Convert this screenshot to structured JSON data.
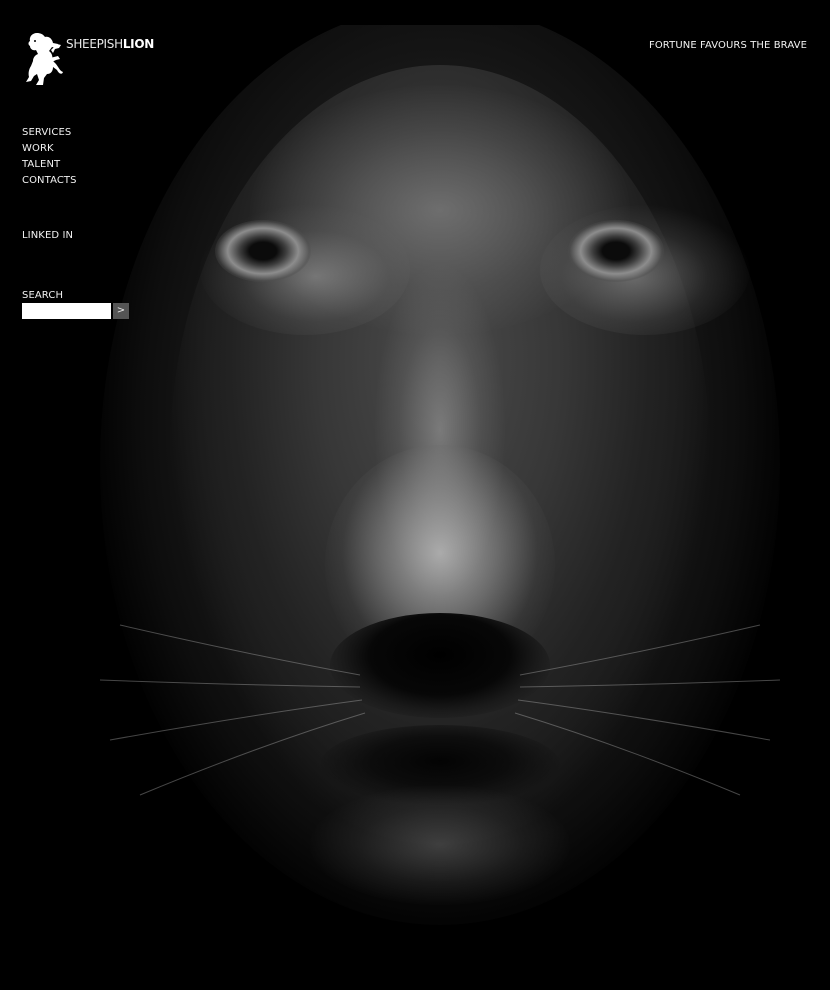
{
  "brand": {
    "name_light": "SHEEPISH",
    "name_bold": "LION",
    "logo_icon": "rampant-lion-crest-icon"
  },
  "header": {
    "tagline": "FORTUNE FAVOURS THE BRAVE"
  },
  "nav": {
    "items": [
      {
        "label": "SERVICES"
      },
      {
        "label": "WORK"
      },
      {
        "label": "TALENT"
      },
      {
        "label": "CONTACTS"
      }
    ]
  },
  "social": {
    "linkedin_label": "LINKED IN"
  },
  "search": {
    "label": "SEARCH",
    "value": "",
    "placeholder": "",
    "button_label": ">"
  },
  "hero": {
    "subject": "lion-face-photo"
  },
  "colors": {
    "background": "#000000",
    "text": "#f2f2f2",
    "search_button": "#555555"
  }
}
